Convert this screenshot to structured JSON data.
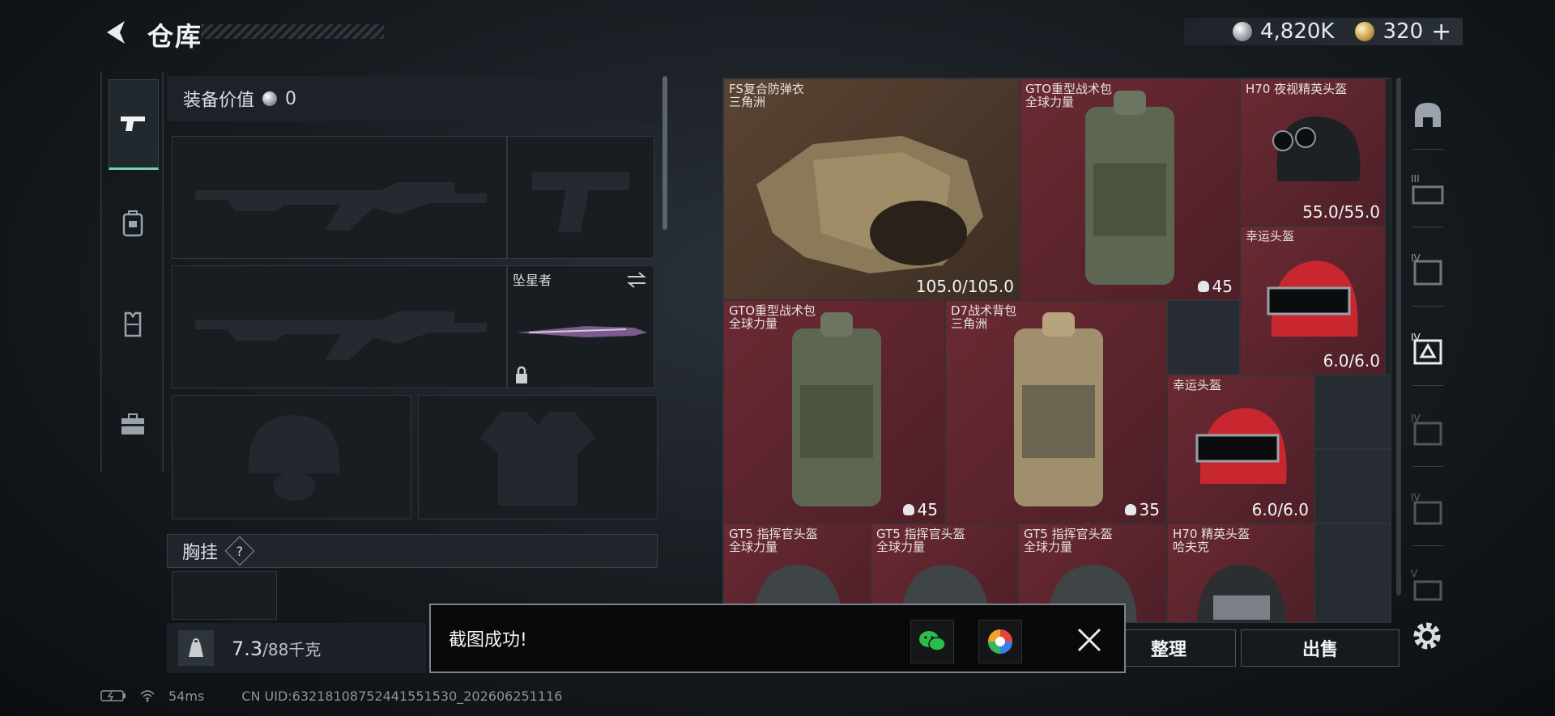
{
  "header": {
    "title": "仓库"
  },
  "currency": {
    "silver": "4,820K",
    "gold": "320",
    "plus": "+"
  },
  "side_tabs": [
    {
      "icon": "pistol-icon",
      "active": true
    },
    {
      "icon": "backpack-icon",
      "active": false
    },
    {
      "icon": "vest-icon",
      "active": false
    },
    {
      "icon": "toolbox-icon",
      "active": false
    }
  ],
  "loadout": {
    "equip_value_label": "装备价值",
    "equip_value": "0",
    "melee_name": "坠星者",
    "chest_rig_label": "胸挂",
    "help": "?"
  },
  "weight": {
    "current": "7.3",
    "max": "/88千克"
  },
  "grid_items": [
    {
      "name": "FS复合防弹衣",
      "sub": "三角洲",
      "value": "105.0/105.0"
    },
    {
      "name": "GTO重型战术包",
      "sub": "全球力量",
      "value": "45"
    },
    {
      "name": "H70 夜视精英头盔",
      "sub": "",
      "value": "55.0/55.0"
    },
    {
      "name": "幸运头盔",
      "sub": "",
      "value": "6.0/6.0"
    },
    {
      "name": "GTO重型战术包",
      "sub": "全球力量",
      "value": "45"
    },
    {
      "name": "D7战术背包",
      "sub": "三角洲",
      "value": "35"
    },
    {
      "name": "幸运头盔",
      "sub": "",
      "value": "6.0/6.0"
    },
    {
      "name": "GT5 指挥官头盔",
      "sub": "全球力量",
      "value": ""
    },
    {
      "name": "GT5 指挥官头盔",
      "sub": "全球力量",
      "value": ""
    },
    {
      "name": "GT5 指挥官头盔",
      "sub": "全球力量",
      "value": ""
    },
    {
      "name": "H70 精英头盔",
      "sub": "哈夫克",
      "value": ""
    }
  ],
  "rail": [
    "helmet-category-icon",
    "III",
    "IV",
    "IV",
    "IV",
    "IV",
    "V"
  ],
  "actions": {
    "sort": "整理",
    "sell": "出售"
  },
  "toast": {
    "message": "截图成功!"
  },
  "status": {
    "ping": "54ms",
    "uid": "CN UID:63218108752441551530_202606251116"
  }
}
